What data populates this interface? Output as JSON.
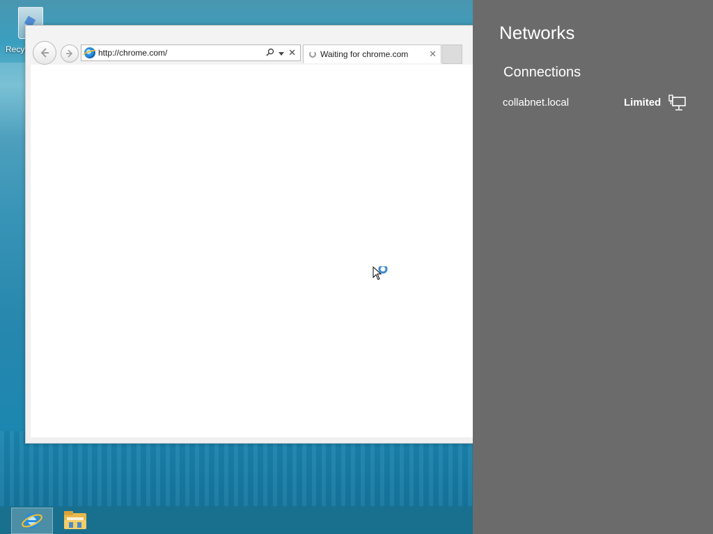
{
  "desktop": {
    "recycle_bin_label": "Recyc"
  },
  "browser": {
    "address_url": "http://chrome.com/",
    "tab_title": "Waiting for chrome.com",
    "tab_close": "✕",
    "address_stop": "✕"
  },
  "networks_panel": {
    "title": "Networks",
    "connections_heading": "Connections",
    "connection": {
      "name": "collabnet.local",
      "status": "Limited"
    }
  },
  "taskbar": {
    "items": [
      "Internet Explorer",
      "File Explorer"
    ]
  },
  "colors": {
    "panel_bg": "#6b6b6b",
    "taskbar_bg": "#1a6e8c",
    "ie_blue": "#2a8ddb"
  }
}
